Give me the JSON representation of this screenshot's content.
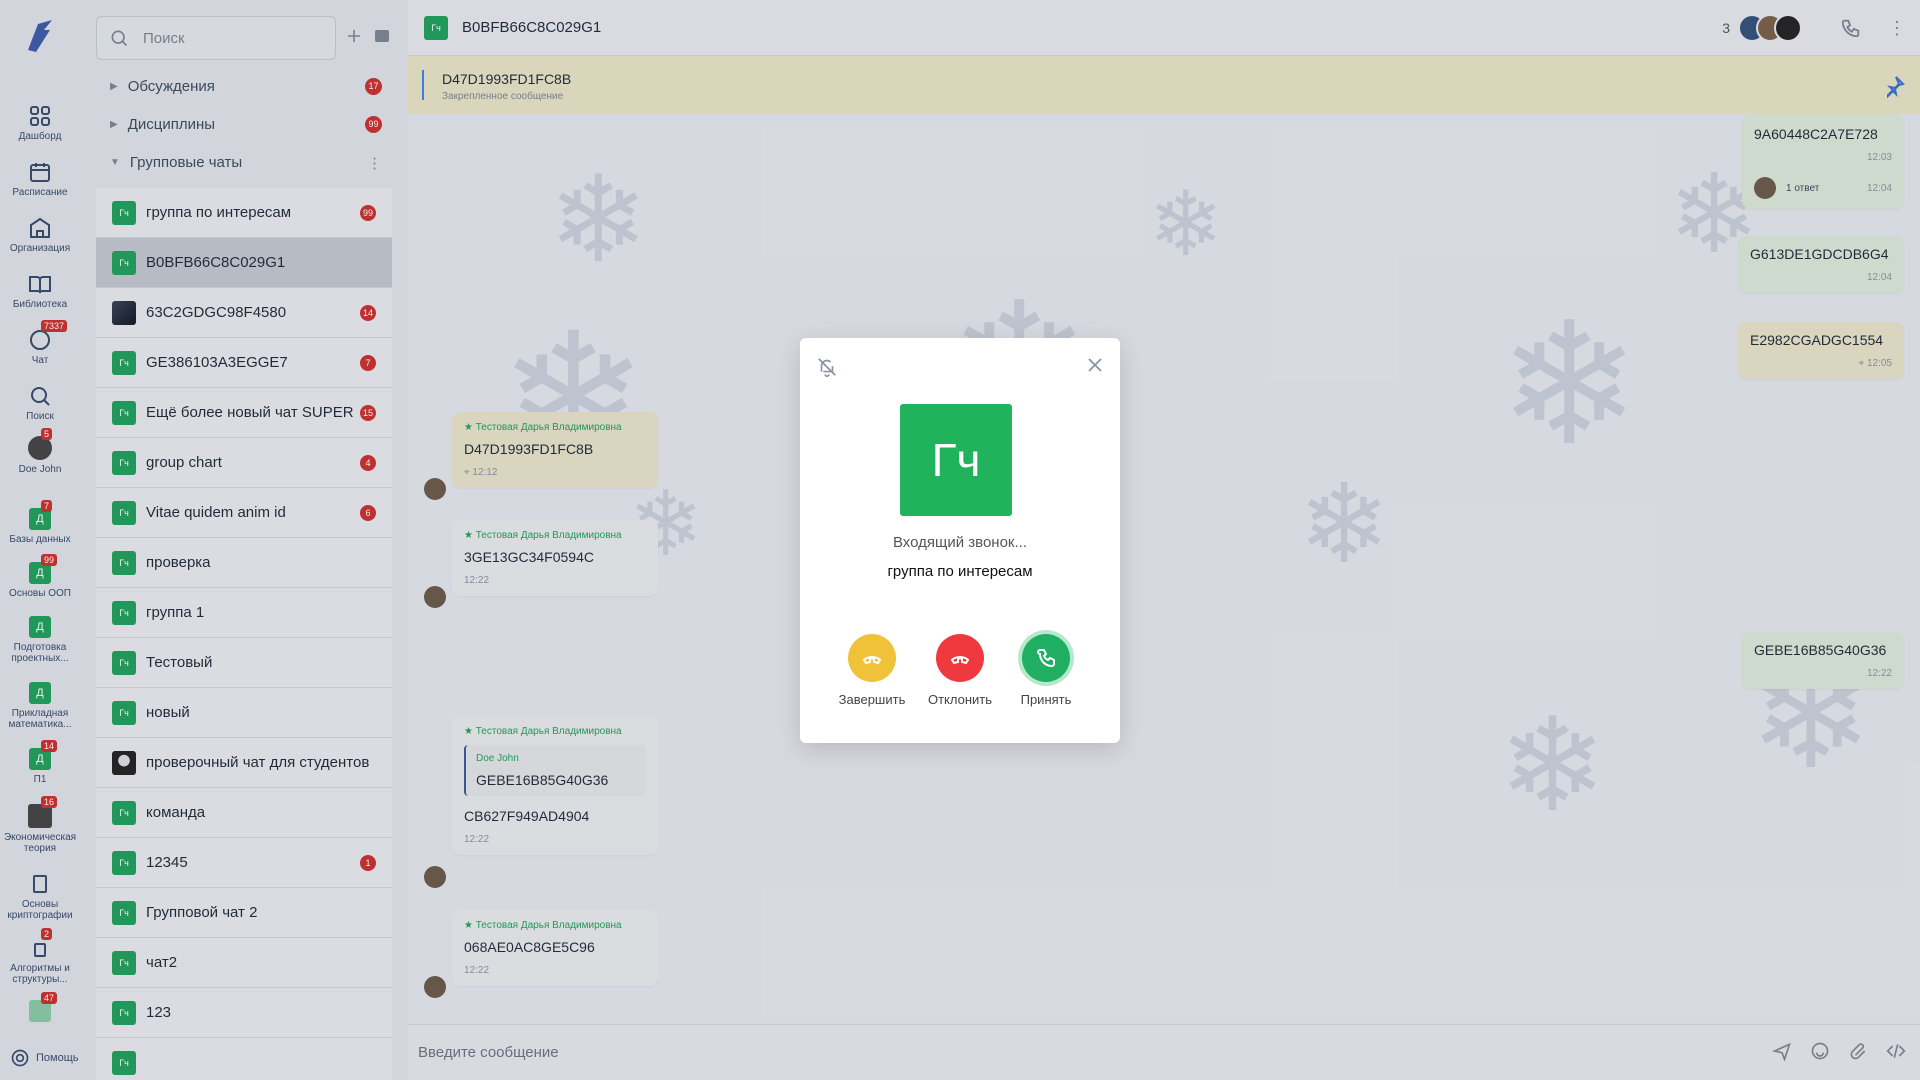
{
  "rail": {
    "items": [
      {
        "label": "Дашборд"
      },
      {
        "label": "Расписание"
      },
      {
        "label": "Организация"
      },
      {
        "label": "Библиотека"
      },
      {
        "label": "Чат",
        "badge": "7337"
      },
      {
        "label": "Поиск"
      },
      {
        "label": "Doe John",
        "badge": "5"
      },
      {
        "label": "Базы данных",
        "badge": "7",
        "chip": "Д"
      },
      {
        "label": "Основы ООП",
        "badge": "99",
        "chip": "Д"
      },
      {
        "label": "Подготовка проектных...",
        "chip": "Д"
      },
      {
        "label": "Прикладная математика...",
        "chip": "Д"
      },
      {
        "label": "П1",
        "badge": "14",
        "chip": "Д"
      },
      {
        "label": "Экономическая теория",
        "badge": "16"
      },
      {
        "label": "Основы криптографии"
      },
      {
        "label": "Алгоритмы и структуры...",
        "badge": "2"
      },
      {
        "label": "",
        "badge": "47"
      }
    ],
    "help": "Помощь"
  },
  "list": {
    "search_placeholder": "Поиск",
    "groups": [
      {
        "label": "Обсуждения",
        "badge": "17"
      },
      {
        "label": "Дисциплины",
        "badge": "99"
      },
      {
        "label": "Групповые чаты"
      }
    ],
    "chats": [
      {
        "chip": "Гч",
        "name": "группа по интересам",
        "badge": "99"
      },
      {
        "chip": "Гч",
        "name": "B0BFB66C8C029G1",
        "badge": ""
      },
      {
        "chip": "",
        "name": "63C2GDGC98F4580",
        "badge": "14"
      },
      {
        "chip": "Гч",
        "name": "GE386103A3EGGE7",
        "badge": "7"
      },
      {
        "chip": "Гч",
        "name": "Ещё более новый чат SUPER",
        "badge": "15"
      },
      {
        "chip": "Гч",
        "name": "group chart",
        "badge": "4"
      },
      {
        "chip": "Гч",
        "name": "Vitae quidem anim id",
        "badge": "6"
      },
      {
        "chip": "Гч",
        "name": "проверка",
        "badge": ""
      },
      {
        "chip": "Гч",
        "name": "группа 1",
        "badge": ""
      },
      {
        "chip": "Гч",
        "name": "Тестовый",
        "badge": ""
      },
      {
        "chip": "Гч",
        "name": "новый",
        "badge": ""
      },
      {
        "chip": "",
        "name": "проверочный чат для студентов",
        "badge": ""
      },
      {
        "chip": "Гч",
        "name": "команда",
        "badge": ""
      },
      {
        "chip": "Гч",
        "name": "12345",
        "badge": "1"
      },
      {
        "chip": "Гч",
        "name": "Групповой чат 2",
        "badge": ""
      },
      {
        "chip": "Гч",
        "name": "чат2",
        "badge": ""
      },
      {
        "chip": "Гч",
        "name": "123",
        "badge": ""
      },
      {
        "chip": "Гч",
        "name": "",
        "badge": ""
      }
    ]
  },
  "header": {
    "chip": "Гч",
    "title": "B0BFB66C8C029G1",
    "members_count": "3"
  },
  "pinned": {
    "text": "D47D1993FD1FC8B",
    "label": "Закрепленное сообщение"
  },
  "messages": {
    "m1": {
      "author": "Тестовая Дарья Владимировна",
      "text": "D47D1993FD1FC8B",
      "time": "12:12"
    },
    "m2": {
      "author": "Тестовая Дарья Владимировна",
      "text": "3GE13GC34F0594C",
      "time": "12:22"
    },
    "m3": {
      "author": "Тестовая Дарья Владимировна",
      "quote_author": "Doe John",
      "quote_text": "GEBE16B85G40G36",
      "text": "CB627F949AD4904",
      "time": "12:22"
    },
    "m4": {
      "author": "Тестовая Дарья Владимировна",
      "text": "068AE0AC8GE5C96",
      "time": "12:22"
    },
    "r1": {
      "text": "9A60448C2A7E728",
      "time": "12:03",
      "reply": "1 ответ",
      "reply_time": "12:04"
    },
    "r2": {
      "text": "G613DE1GDCDB6G4",
      "time": "12:04"
    },
    "r3": {
      "text": "E2982CGADGC1554",
      "time": "12:05"
    },
    "r4": {
      "text": "GEBE16B85G40G36",
      "time": "12:22"
    }
  },
  "composer": {
    "placeholder": "Введите сообщение"
  },
  "call": {
    "avatar": "Гч",
    "status": "Входящий звонок...",
    "group": "группа по интересам",
    "end_label": "Завершить",
    "decline_label": "Отклонить",
    "accept_label": "Принять",
    "colors": {
      "end": "#f0c23a",
      "decline": "#f0393e",
      "accept": "#1fae62"
    }
  }
}
